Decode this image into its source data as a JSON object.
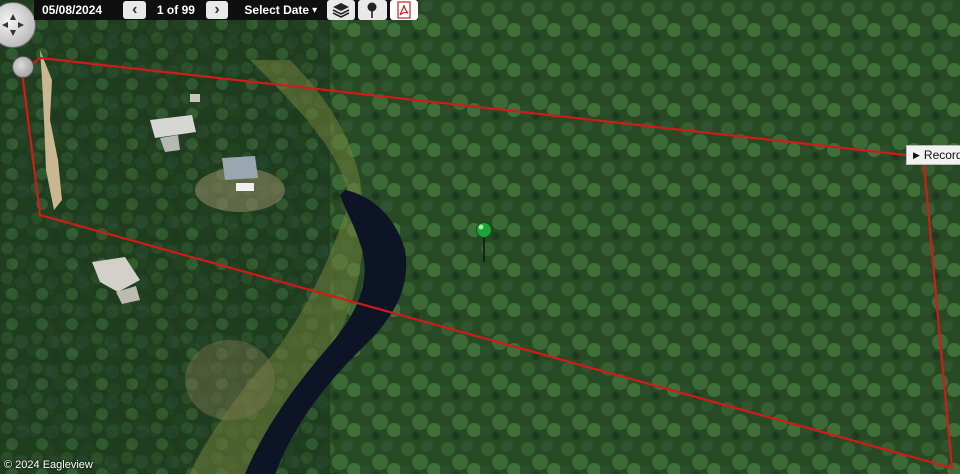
{
  "toolbar": {
    "date": "05/08/2024",
    "prev_glyph": "‹",
    "next_glyph": "›",
    "image_count": "1 of 99",
    "select_date_label": "Select Date",
    "select_date_caret": "▾",
    "icons": [
      "layers-icon",
      "pushpin-icon",
      "pdf-icon"
    ]
  },
  "map": {
    "parcel_outline_color": "#d11a1a",
    "marker_color": "#1ea335"
  },
  "panel": {
    "records_label": "Record",
    "records_glyph": "▶"
  },
  "footer": {
    "copyright": "© 2024 Eagleview"
  }
}
